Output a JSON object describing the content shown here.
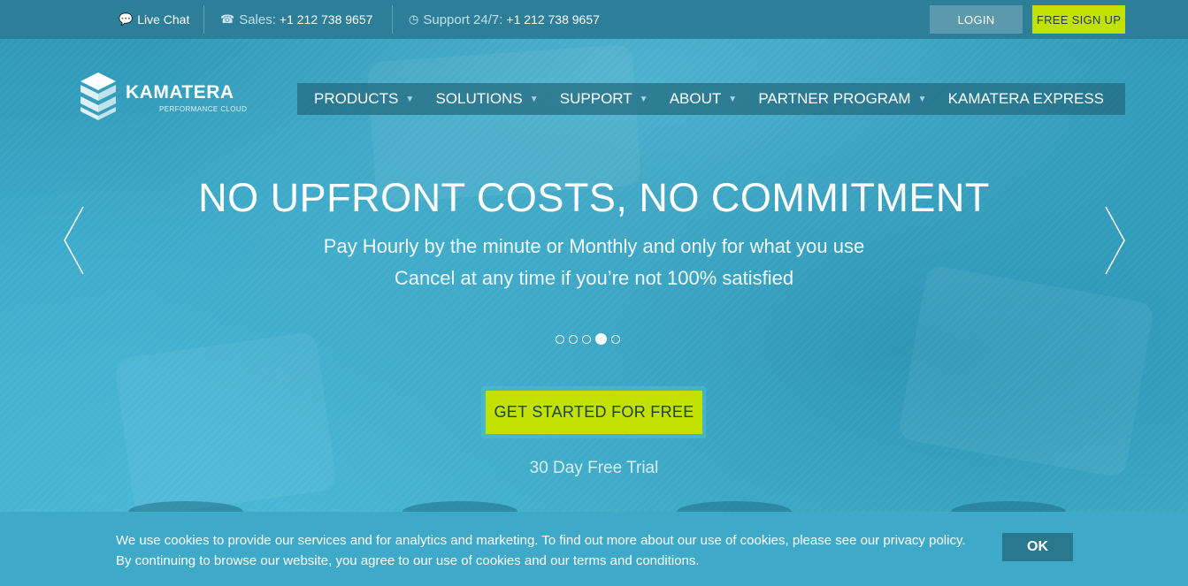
{
  "topbar": {
    "live_chat": "Live Chat",
    "sales_label": "Sales:",
    "sales_phone": "+1 212 738 9657",
    "support_label": "Support 24/7:",
    "support_phone": "+1 212 738 9657",
    "login": "LOGIN",
    "signup": "FREE SIGN UP"
  },
  "logo": {
    "name": "KAMATERA",
    "tagline": "PERFORMANCE CLOUD"
  },
  "nav": {
    "items": [
      {
        "label": "PRODUCTS",
        "dropdown": true
      },
      {
        "label": "SOLUTIONS",
        "dropdown": true
      },
      {
        "label": "SUPPORT",
        "dropdown": true
      },
      {
        "label": "ABOUT",
        "dropdown": true
      },
      {
        "label": "PARTNER PROGRAM",
        "dropdown": true
      },
      {
        "label": "KAMATERA EXPRESS",
        "dropdown": false
      }
    ]
  },
  "hero": {
    "headline": "NO UPFRONT COSTS, NO COMMITMENT",
    "line1": "Pay Hourly by the minute or Monthly and only for what you use",
    "line2": "Cancel at any time if you’re not 100% satisfied",
    "slides_total": 5,
    "active_slide": 4,
    "cta": "GET STARTED FOR FREE",
    "trial": "30 Day Free Trial"
  },
  "cookie": {
    "line1": "We use cookies to provide our services and for analytics and marketing. To find out more about our use of cookies, please see our privacy policy.",
    "line2": "By continuing to browse our website, you agree to our use of cookies and our terms and conditions.",
    "ok": "OK"
  },
  "colors": {
    "accent_green": "#c3e100",
    "topbar": "#2d7f99",
    "hero": "#3aa7c6"
  }
}
